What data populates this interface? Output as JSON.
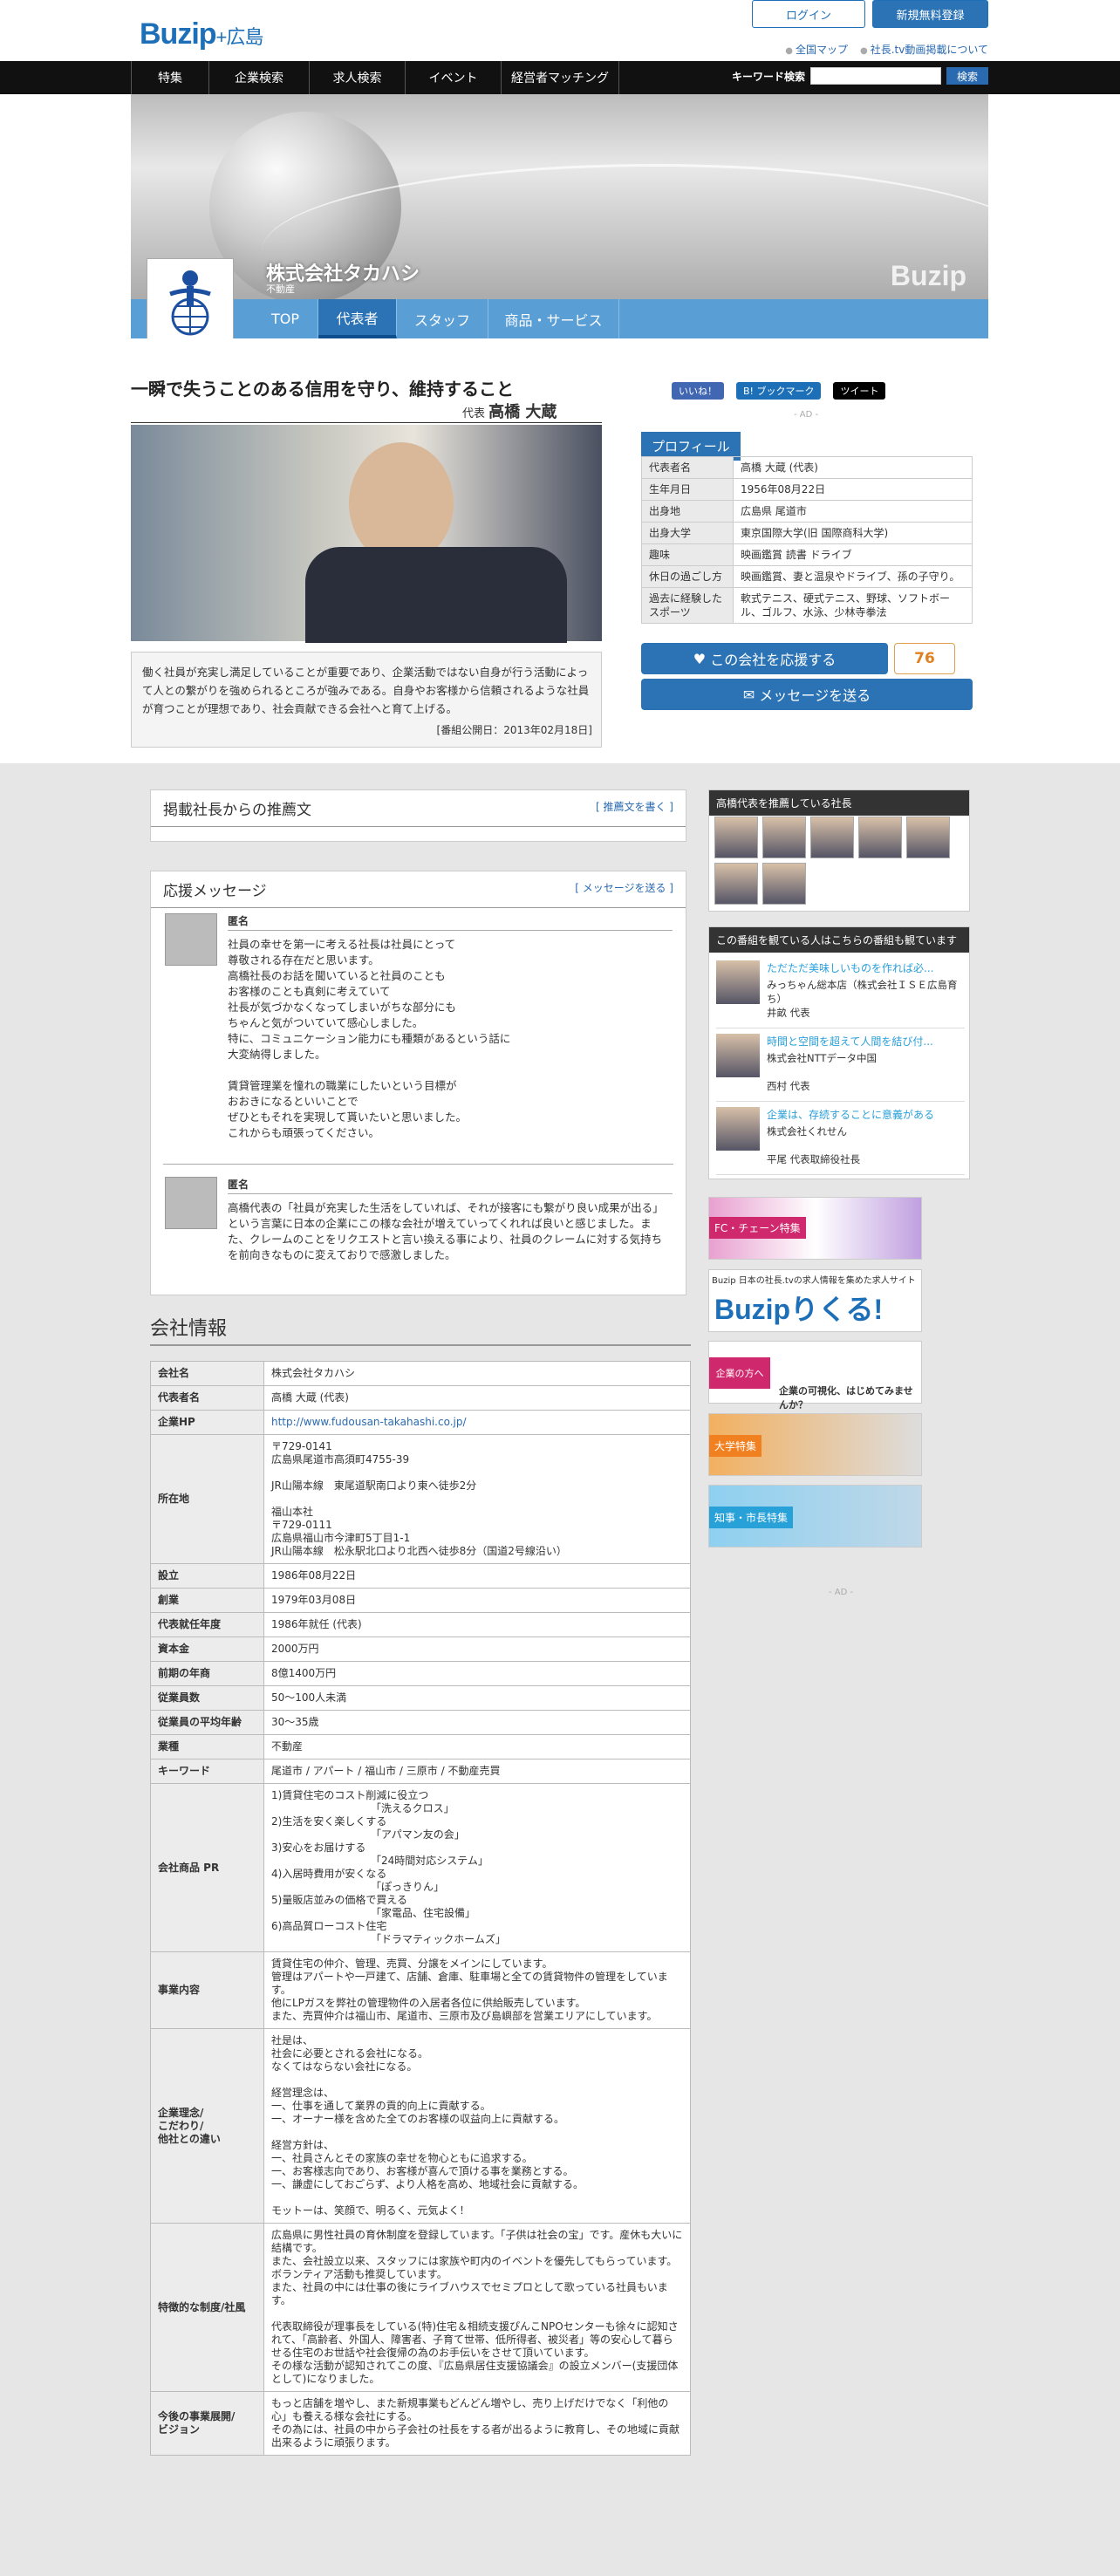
{
  "header": {
    "logo": "Buzip",
    "logo_region": "+広島",
    "login": "ログイン",
    "register": "新規無料登録",
    "map_link": "全国マップ",
    "about_link": "社長.tv動画掲載について"
  },
  "nav": {
    "items": [
      "特集",
      "企業検索",
      "求人検索",
      "イベント",
      "経営者マッチング"
    ],
    "keyword_label": "キーワード検索",
    "search_btn": "検索"
  },
  "company": {
    "name": "株式会社タカハシ",
    "industry": "不動産",
    "watermark": "Buzip"
  },
  "tabs": [
    "TOP",
    "代表者",
    "スタッフ",
    "商品・サービス"
  ],
  "main": {
    "headline": "一瞬で失うことのある信用を守り、維持すること",
    "rep_label": "代表",
    "rep_name": "高橋 大蔵",
    "quote": "働く社員が充実し満足していることが重要であり、企業活動ではない自身が行う活動によって人との繋がりを強められるところが強みである。自身やお客様から信頼されるような社員が育つことが理想であり、社会貢献できる会社へと育て上げる。",
    "date": "[番組公開日：2013年02月18日]"
  },
  "social": {
    "like": "いいね！",
    "hatena": "B! ブックマーク",
    "tweet": "ツイート",
    "ad": "- AD -"
  },
  "profile": {
    "title": "プロフィール",
    "rows": [
      [
        "代表者名",
        "高橋 大蔵 (代表)"
      ],
      [
        "生年月日",
        "1956年08月22日"
      ],
      [
        "出身地",
        "広島県 尾道市"
      ],
      [
        "出身大学",
        "東京国際大学(旧 国際商科大学)"
      ],
      [
        "趣味",
        "映画鑑賞 読書 ドライブ"
      ],
      [
        "休日の過ごし方",
        "映画鑑賞、妻と温泉やドライブ、孫の子守り。"
      ],
      [
        "過去に経験したスポーツ",
        "軟式テニス、硬式テニス、野球、ソフトボール、ゴルフ、水泳、少林寺拳法"
      ]
    ]
  },
  "support": {
    "btn": "この会社を応援する",
    "count": "76",
    "msg_btn": "メッセージを送る"
  },
  "recommend": {
    "title": "掲載社長からの推薦文",
    "link": "[ 推薦文を書く ]"
  },
  "messages": {
    "title": "応援メッセージ",
    "link": "[ メッセージを送る ]",
    "items": [
      {
        "name": "匿名",
        "text": "社員の幸せを第一に考える社長は社員にとって\n尊敬される存在だと思います。\n高橋社長のお話を聞いていると社員のことも\nお客様のことも真剣に考えていて\n社長が気づかなくなってしまいがちな部分にも\nちゃんと気がついていて感心しました。\n特に、コミュニケーション能力にも種類があるという話に\n大変納得しました。\n\n賃貸管理業を憧れの職業にしたいという目標が\nおおきになるといいことで\nぜひともそれを実現して貰いたいと思いました。\nこれからも頑張ってください。"
      },
      {
        "name": "匿名",
        "text": "高橋代表の「社員が充実した生活をしていれば、それが接客にも繋がり良い成果が出る」という言葉に日本の企業にこの様な会社が増えていってくれれば良いと感じました。また、クレームのことをリクエストと言い換える事により、社員のクレームに対する気持ちを前向きなものに変えておりで感激しました。"
      }
    ]
  },
  "info": {
    "title": "会社情報",
    "rows": [
      [
        "会社名",
        "株式会社タカハシ"
      ],
      [
        "代表者名",
        "高橋 大蔵 (代表)"
      ],
      [
        "企業HP",
        "http://www.fudousan-takahashi.co.jp/"
      ],
      [
        "所在地",
        "〒729-0141\n広島県尾道市高須町4755-39\n\nJR山陽本線　東尾道駅南口より東へ徒歩2分\n\n福山本社\n〒729-0111\n広島県福山市今津町5丁目1-1\nJR山陽本線　松永駅北口より北西へ徒歩8分（国道2号線沿い）"
      ],
      [
        "設立",
        "1986年08月22日"
      ],
      [
        "創業",
        "1979年03月08日"
      ],
      [
        "代表就任年度",
        "1986年就任 (代表)"
      ],
      [
        "資本金",
        "2000万円"
      ],
      [
        "前期の年商",
        "8億1400万円"
      ],
      [
        "従業員数",
        "50〜100人未満"
      ],
      [
        "従業員の平均年齢",
        "30〜35歳"
      ],
      [
        "業種",
        "不動産"
      ],
      [
        "キーワード",
        "尾道市 / アパート / 福山市 / 三原市 / 不動産売買"
      ],
      [
        "会社商品 PR",
        "1)賃貸住宅のコスト削減に役立つ\n　　　　　　　　　　「洗えるクロス」\n2)生活を安く楽しくする\n　　　　　　　　　　「アパマン友の会」\n3)安心をお届けする\n　　　　　　　　　　「24時間対応システム」\n4)入居時費用が安くなる\n　　　　　　　　　　「ぽっきりん」\n5)量販店並みの価格で買える\n　　　　　　　　　　「家電品、住宅設備」\n6)高品質ローコスト住宅\n　　　　　　　　　　「ドラマティックホームズ」"
      ],
      [
        "事業内容",
        "賃貸住宅の仲介、管理、売買、分譲をメインにしています。\n管理はアパートや一戸建て、店舗、倉庫、駐車場と全ての賃貸物件の管理をしています。\n他にLPガスを弊社の管理物件の入居者各位に供給販売しています。\nまた、売買仲介は福山市、尾道市、三原市及び島嶼部を営業エリアにしています。"
      ],
      [
        "企業理念/\nこだわり/\n他社との違い",
        "社是は、\n社会に必要とされる会社になる。\nなくてはならない会社になる。\n\n経営理念は、\n一、仕事を通して業界の貢的向上に貢献する。\n一、オーナー様を含めた全てのお客様の収益向上に貢献する。\n\n経営方針は、\n一、社員さんとその家族の幸せを物心ともに追求する。\n一、お客様志向であり、お客様が喜んで頂ける事を業務とする。\n一、謙虚にしておごらず、より人格を高め、地域社会に貢献する。\n\nモットーは、笑顔で、明るく、元気よく！"
      ],
      [
        "特徴的な制度/社風",
        "広島県に男性社員の育休制度を登録しています。「子供は社会の宝」です。産休も大いに結構です。\nまた、会社設立以来、スタッフには家族や町内のイベントを優先してもらっています。ボランティア活動も推奨しています。\nまた、社員の中には仕事の後にライブハウスでセミプロとして歌っている社員もいます。\n\n代表取締役が理事長をしている(特)住宅＆相続支援ぴんこNPOセンターも徐々に認知されて、「高齢者、外国人、障害者、子育て世帯、低所得者、被災者」等の安心して暮らせる住宅のお世話や社会復帰の為のお手伝いをさせて頂いています。\nその様な活動が認知されてこの度、『広島県居住支援協議会』の設立メンバー(支援団体として)になりました。"
      ],
      [
        "今後の事業展開/\nビジョン",
        "もっと店舗を増やし、また新規事業もどんどん増やし、売り上げだけでなく「利他の心」も養える様な会社にする。\nその為には、社員の中から子会社の社長をする者が出るように教育し、その地域に貢献出来るように頑張ります。"
      ]
    ]
  },
  "sidebar": {
    "recommend_head": "高橋代表を推薦している社長",
    "watch_head": "この番組を観ている人はこちらの番組も観ています",
    "related": [
      {
        "title": "ただただ美味しいものを作れば必...",
        "company": "みっちゃん総本店（株式会社ＩＳＥ広島育ち）",
        "person": "井畝 代表"
      },
      {
        "title": "時間と空間を超えて人間を結び付...",
        "company": "株式会社NTTデータ中国",
        "person": "西村 代表"
      },
      {
        "title": "企業は、存続することに意義がある",
        "company": "株式会社くれせん",
        "person": "平尾 代表取締役社長"
      }
    ],
    "banners": [
      "FC・チェーン特集",
      "Buzip 日本の社長.tvの求人情報を集めた求人サイト",
      "Buzipりくる!",
      "企業の方へ",
      "企業の可視化、はじめてみませんか？",
      "大学特集",
      "知事・市長特集"
    ],
    "ad": "- AD -"
  }
}
